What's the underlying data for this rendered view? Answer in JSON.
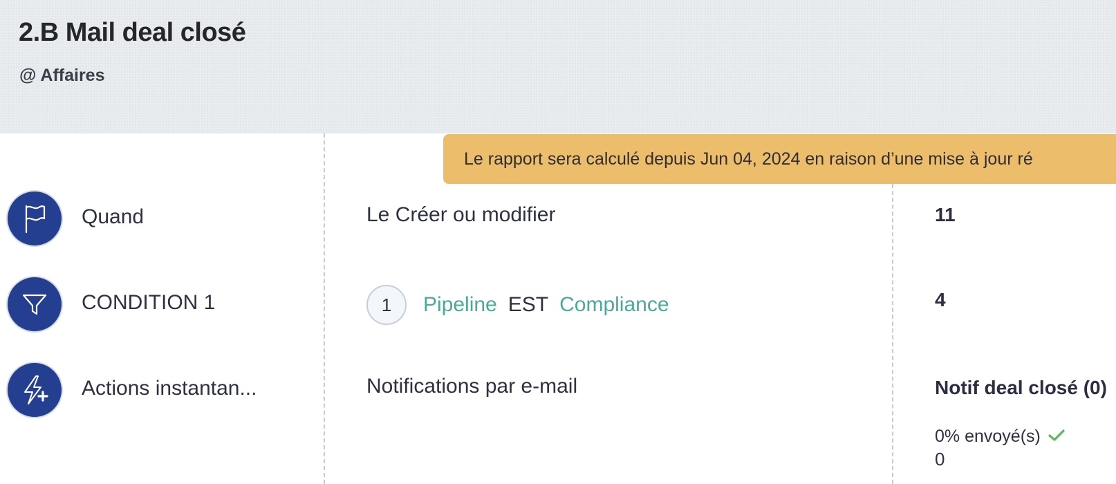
{
  "header": {
    "title": "2.B Mail deal closé",
    "module": "@ Affaires"
  },
  "banner": {
    "text": "Le rapport sera calculé depuis Jun 04, 2024 en raison d’une mise à jour ré"
  },
  "steps": [
    {
      "label": "Quand",
      "icon": "flag-icon"
    },
    {
      "label": "CONDITION 1",
      "icon": "filter-icon"
    },
    {
      "label": "Actions instantan...",
      "icon": "lightning-plus-icon"
    }
  ],
  "trigger": {
    "text": "Le Créer ou modifier",
    "count": "11"
  },
  "condition": {
    "number": "1",
    "field": "Pipeline",
    "operator": "EST",
    "value": "Compliance",
    "count": "4"
  },
  "actions": {
    "type": "Notifications par e-mail",
    "name": "Notif deal closé (0)",
    "sent_text": "0% envoyé(s)",
    "sent_count": "0"
  },
  "colors": {
    "step_circle": "#243f8f",
    "banner": "#ecbd6b",
    "condition_link": "#4aaa98",
    "check": "#5cb85c"
  }
}
